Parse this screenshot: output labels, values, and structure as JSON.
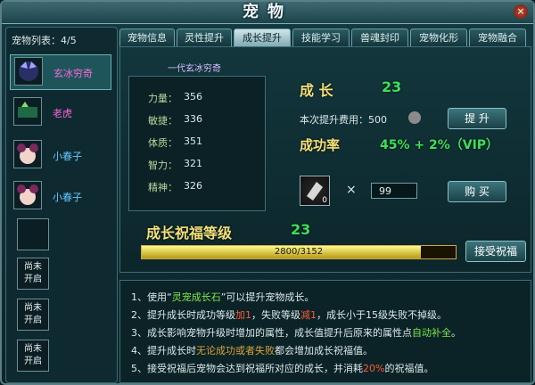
{
  "window": {
    "title": "宠物",
    "close": "×"
  },
  "left": {
    "title": "宠物列表：4/5",
    "pets": [
      {
        "name": "玄冰穷奇",
        "color": "#ff66d6"
      },
      {
        "name": "老虎",
        "color": "#ff66d6"
      },
      {
        "name": "小春子",
        "color": "#66c8ff"
      },
      {
        "name": "小春子",
        "color": "#66c8ff"
      }
    ],
    "locked": [
      "尚未\n开启",
      "尚未\n开启",
      "尚未\n开启"
    ]
  },
  "tabs": [
    "宠物信息",
    "灵性提升",
    "成长提升",
    "技能学习",
    "兽魂封印",
    "宠物化形",
    "宠物融合"
  ],
  "pet_title": "一代玄冰穷奇",
  "stats": [
    {
      "label": "力量：",
      "value": "356"
    },
    {
      "label": "敏捷：",
      "value": "336"
    },
    {
      "label": "体质：",
      "value": "351"
    },
    {
      "label": "智力：",
      "value": "321"
    },
    {
      "label": "精神：",
      "value": "326"
    }
  ],
  "growth": {
    "label": "成  长",
    "value": "23"
  },
  "cost": {
    "label": "本次提升费用：500"
  },
  "buttons": {
    "upgrade": "提 升",
    "buy": "购 买",
    "accept": "接受祝福"
  },
  "success": {
    "label": "成功率",
    "value": "45% + 2%（VIP）"
  },
  "item": {
    "count": "0",
    "x": "×",
    "qty": "99"
  },
  "blessing": {
    "label": "成长祝福等级",
    "value": "23",
    "progress": "2800/3152",
    "fraction": 0.888
  },
  "notes": [
    [
      "1、使用“",
      "灵宠成长石",
      "”可以提升宠物成长。"
    ],
    [
      "2、提升成长时成功等级",
      "加1",
      "，失败等级",
      "减1",
      "，成长小于15级失败不掉级。"
    ],
    [
      "3、成长影响宠物升级时增加的属性，成长值提升后原来的属性点",
      "自动补全",
      "。"
    ],
    [
      "4、提升成长时",
      "无论成功或者失败",
      "都会增加成长祝福值。"
    ],
    [
      "5、接受祝福后宠物会达到祝福所对应的成长，并消耗",
      "20%",
      "的祝福值。"
    ]
  ]
}
